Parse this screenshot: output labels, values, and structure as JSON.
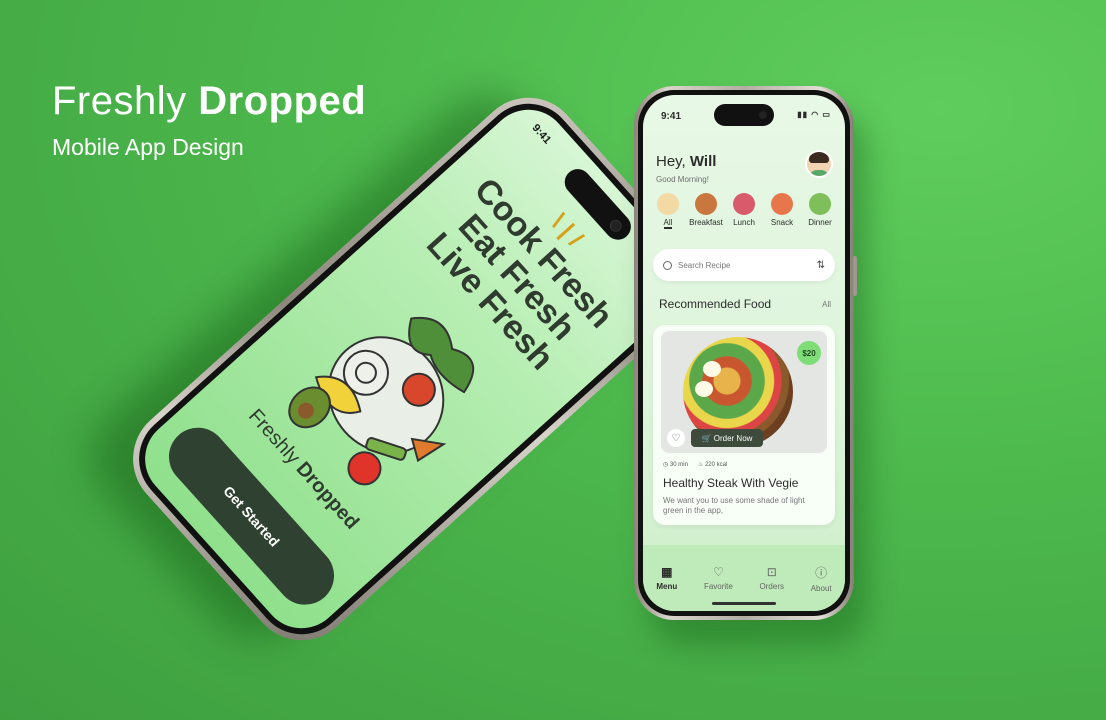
{
  "header": {
    "title_light": "Freshly",
    "title_bold": "Dropped",
    "subtitle": "Mobile App Design"
  },
  "splash": {
    "time": "9:41",
    "slogan": [
      "Cook Fresh",
      "Eat Fresh",
      "Live Fresh"
    ],
    "brand_light": "Freshly",
    "brand_bold": "Dropped",
    "cta_label": "Get Started"
  },
  "home": {
    "time": "9:41",
    "greeting_prefix": "Hey,",
    "greeting_name": "Will",
    "greeting_sub": "Good Morning!",
    "categories": [
      {
        "label": "All",
        "color": "#f3d9a4"
      },
      {
        "label": "Breakfast",
        "color": "#c9773e"
      },
      {
        "label": "Lunch",
        "color": "#d95a6a"
      },
      {
        "label": "Snack",
        "color": "#e7774b"
      },
      {
        "label": "Dinner",
        "color": "#7fbf5a"
      }
    ],
    "search_placeholder": "Search Recipe",
    "section_title": "Recommended Food",
    "section_link": "All",
    "card": {
      "price": "$20",
      "order_label": "Order Now",
      "time": "30 min",
      "calories": "220 kcal",
      "title": "Healthy Steak With Vegie",
      "description": "We want you to use some shade of light green in the app,"
    },
    "tabs": [
      {
        "label": "Menu",
        "icon": "grid-icon"
      },
      {
        "label": "Favorite",
        "icon": "heart-icon"
      },
      {
        "label": "Orders",
        "icon": "bag-icon"
      },
      {
        "label": "About",
        "icon": "info-icon"
      }
    ]
  }
}
